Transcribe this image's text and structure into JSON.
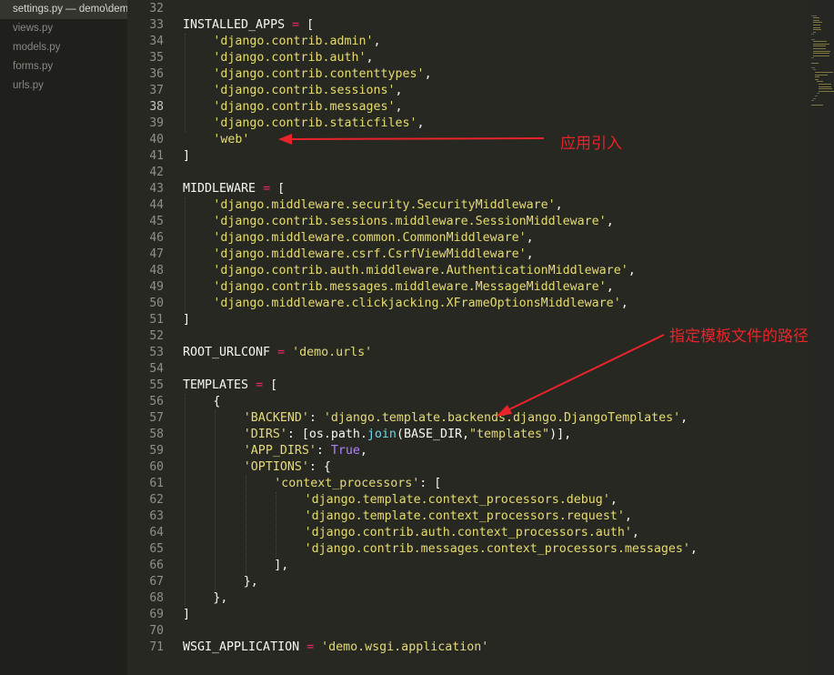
{
  "sidebar": {
    "files": [
      {
        "name": "settings.py — demo\\demo",
        "active": true
      },
      {
        "name": "views.py",
        "active": false
      },
      {
        "name": "models.py",
        "active": false
      },
      {
        "name": "forms.py",
        "active": false
      },
      {
        "name": "urls.py",
        "active": false
      }
    ]
  },
  "editor": {
    "current_line": 38,
    "lines": [
      {
        "n": 32,
        "indent": 0,
        "tokens": []
      },
      {
        "n": 33,
        "indent": 0,
        "tokens": [
          [
            "t",
            "INSTALLED_APPS "
          ],
          [
            "op",
            "="
          ],
          [
            "t",
            " ["
          ]
        ]
      },
      {
        "n": 34,
        "indent": 1,
        "tokens": [
          [
            "s",
            "'django.contrib.admin'"
          ],
          [
            "t",
            ","
          ]
        ]
      },
      {
        "n": 35,
        "indent": 1,
        "tokens": [
          [
            "s",
            "'django.contrib.auth'"
          ],
          [
            "t",
            ","
          ]
        ]
      },
      {
        "n": 36,
        "indent": 1,
        "tokens": [
          [
            "s",
            "'django.contrib.contenttypes'"
          ],
          [
            "t",
            ","
          ]
        ]
      },
      {
        "n": 37,
        "indent": 1,
        "tokens": [
          [
            "s",
            "'django.contrib.sessions'"
          ],
          [
            "t",
            ","
          ]
        ]
      },
      {
        "n": 38,
        "indent": 1,
        "tokens": [
          [
            "s",
            "'django.contrib.messages'"
          ],
          [
            "t",
            ","
          ]
        ]
      },
      {
        "n": 39,
        "indent": 1,
        "tokens": [
          [
            "s",
            "'django.contrib.staticfiles'"
          ],
          [
            "t",
            ","
          ]
        ]
      },
      {
        "n": 40,
        "indent": 1,
        "tokens": [
          [
            "s",
            "'web'"
          ]
        ]
      },
      {
        "n": 41,
        "indent": 0,
        "tokens": [
          [
            "t",
            "]"
          ]
        ]
      },
      {
        "n": 42,
        "indent": 0,
        "tokens": []
      },
      {
        "n": 43,
        "indent": 0,
        "tokens": [
          [
            "t",
            "MIDDLEWARE "
          ],
          [
            "op",
            "="
          ],
          [
            "t",
            " ["
          ]
        ]
      },
      {
        "n": 44,
        "indent": 1,
        "tokens": [
          [
            "s",
            "'django.middleware.security.SecurityMiddleware'"
          ],
          [
            "t",
            ","
          ]
        ]
      },
      {
        "n": 45,
        "indent": 1,
        "tokens": [
          [
            "s",
            "'django.contrib.sessions.middleware.SessionMiddleware'"
          ],
          [
            "t",
            ","
          ]
        ]
      },
      {
        "n": 46,
        "indent": 1,
        "tokens": [
          [
            "s",
            "'django.middleware.common.CommonMiddleware'"
          ],
          [
            "t",
            ","
          ]
        ]
      },
      {
        "n": 47,
        "indent": 1,
        "tokens": [
          [
            "s",
            "'django.middleware.csrf.CsrfViewMiddleware'"
          ],
          [
            "t",
            ","
          ]
        ]
      },
      {
        "n": 48,
        "indent": 1,
        "tokens": [
          [
            "s",
            "'django.contrib.auth.middleware.AuthenticationMiddleware'"
          ],
          [
            "t",
            ","
          ]
        ]
      },
      {
        "n": 49,
        "indent": 1,
        "tokens": [
          [
            "s",
            "'django.contrib.messages.middleware.MessageMiddleware'"
          ],
          [
            "t",
            ","
          ]
        ]
      },
      {
        "n": 50,
        "indent": 1,
        "tokens": [
          [
            "s",
            "'django.middleware.clickjacking.XFrameOptionsMiddleware'"
          ],
          [
            "t",
            ","
          ]
        ]
      },
      {
        "n": 51,
        "indent": 0,
        "tokens": [
          [
            "t",
            "]"
          ]
        ]
      },
      {
        "n": 52,
        "indent": 0,
        "tokens": []
      },
      {
        "n": 53,
        "indent": 0,
        "tokens": [
          [
            "t",
            "ROOT_URLCONF "
          ],
          [
            "op",
            "="
          ],
          [
            "t",
            " "
          ],
          [
            "s",
            "'demo.urls'"
          ]
        ]
      },
      {
        "n": 54,
        "indent": 0,
        "tokens": []
      },
      {
        "n": 55,
        "indent": 0,
        "tokens": [
          [
            "t",
            "TEMPLATES "
          ],
          [
            "op",
            "="
          ],
          [
            "t",
            " ["
          ]
        ]
      },
      {
        "n": 56,
        "indent": 1,
        "tokens": [
          [
            "t",
            "{"
          ]
        ]
      },
      {
        "n": 57,
        "indent": 2,
        "tokens": [
          [
            "s",
            "'BACKEND'"
          ],
          [
            "t",
            ": "
          ],
          [
            "s",
            "'django.template.backends.django.DjangoTemplates'"
          ],
          [
            "t",
            ","
          ]
        ]
      },
      {
        "n": 58,
        "indent": 2,
        "tokens": [
          [
            "s",
            "'DIRS'"
          ],
          [
            "t",
            ": [os.path."
          ],
          [
            "bi",
            "join"
          ],
          [
            "t",
            "(BASE_DIR,"
          ],
          [
            "s",
            "\"templates\""
          ],
          [
            "t",
            ")],"
          ]
        ]
      },
      {
        "n": 59,
        "indent": 2,
        "tokens": [
          [
            "s",
            "'APP_DIRS'"
          ],
          [
            "t",
            ": "
          ],
          [
            "kw",
            "True"
          ],
          [
            "t",
            ","
          ]
        ]
      },
      {
        "n": 60,
        "indent": 2,
        "tokens": [
          [
            "s",
            "'OPTIONS'"
          ],
          [
            "t",
            ": {"
          ]
        ]
      },
      {
        "n": 61,
        "indent": 3,
        "tokens": [
          [
            "s",
            "'context_processors'"
          ],
          [
            "t",
            ": ["
          ]
        ]
      },
      {
        "n": 62,
        "indent": 4,
        "tokens": [
          [
            "s",
            "'django.template.context_processors.debug'"
          ],
          [
            "t",
            ","
          ]
        ]
      },
      {
        "n": 63,
        "indent": 4,
        "tokens": [
          [
            "s",
            "'django.template.context_processors.request'"
          ],
          [
            "t",
            ","
          ]
        ]
      },
      {
        "n": 64,
        "indent": 4,
        "tokens": [
          [
            "s",
            "'django.contrib.auth.context_processors.auth'"
          ],
          [
            "t",
            ","
          ]
        ]
      },
      {
        "n": 65,
        "indent": 4,
        "tokens": [
          [
            "s",
            "'django.contrib.messages.context_processors.messages'"
          ],
          [
            "t",
            ","
          ]
        ]
      },
      {
        "n": 66,
        "indent": 3,
        "tokens": [
          [
            "t",
            "],"
          ]
        ]
      },
      {
        "n": 67,
        "indent": 2,
        "tokens": [
          [
            "t",
            "},"
          ]
        ]
      },
      {
        "n": 68,
        "indent": 1,
        "tokens": [
          [
            "t",
            "},"
          ]
        ]
      },
      {
        "n": 69,
        "indent": 0,
        "tokens": [
          [
            "t",
            "]"
          ]
        ]
      },
      {
        "n": 70,
        "indent": 0,
        "tokens": []
      },
      {
        "n": 71,
        "indent": 0,
        "tokens": [
          [
            "t",
            "WSGI_APPLICATION "
          ],
          [
            "op",
            "="
          ],
          [
            "t",
            " "
          ],
          [
            "s",
            "'demo.wsgi.application'"
          ]
        ]
      }
    ]
  },
  "annotations": {
    "apps_note": "应用引入",
    "templates_note": "指定模板文件的路径"
  },
  "colors": {
    "background": "#272822",
    "string": "#e6db74",
    "operator": "#f92672",
    "builtin": "#66d9ef",
    "constant": "#ae81ff",
    "annotation": "#e8242a"
  }
}
